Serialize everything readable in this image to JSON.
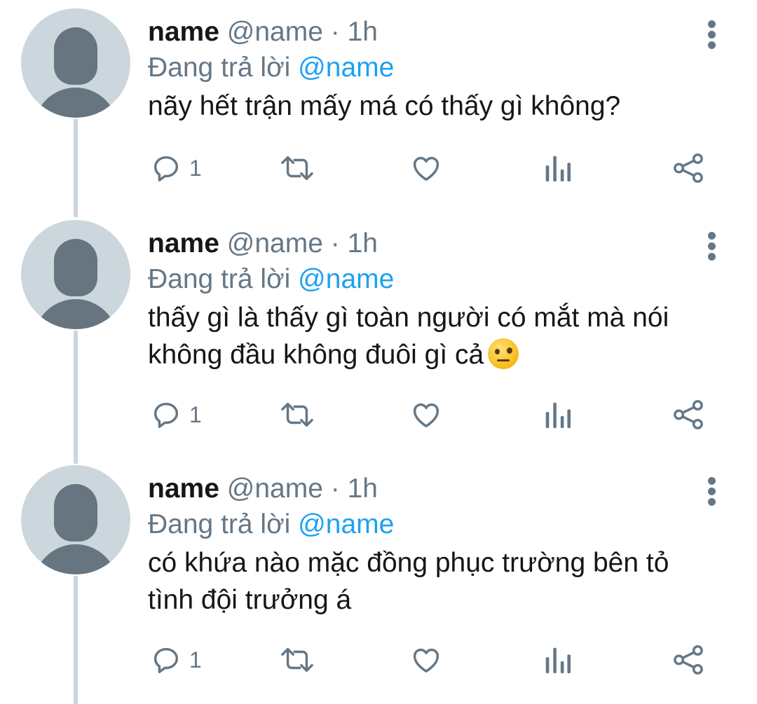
{
  "colors": {
    "text": "#14171a",
    "secondary": "#657786",
    "accent": "#1da1f2",
    "avatar_bg": "#ccd6dd",
    "avatar_fg": "#66757f",
    "thread_line": "#ccd6dd"
  },
  "icons": [
    "more-icon",
    "reply-icon",
    "retweet-icon",
    "like-icon",
    "analytics-icon",
    "share-icon",
    "default-avatar-icon"
  ],
  "tweets": [
    {
      "name": "name",
      "handle": "@name",
      "dot": "·",
      "time": "1h",
      "reply_prefix": "Đang trả lời",
      "reply_to": "@name",
      "text_lines": [
        "nãy hết trận mấy má có thấy gì không?"
      ],
      "emoji": null,
      "reply_count": "1"
    },
    {
      "name": "name",
      "handle": "@name",
      "dot": "·",
      "time": "1h",
      "reply_prefix": "Đang trả lời",
      "reply_to": "@name",
      "text_lines": [
        "thấy gì là thấy gì toàn người có mắt mà nói",
        "không đầu không đuôi gì cả"
      ],
      "emoji": "face-with-raised-eyebrow",
      "reply_count": "1"
    },
    {
      "name": "name",
      "handle": "@name",
      "dot": "·",
      "time": "1h",
      "reply_prefix": "Đang trả lời",
      "reply_to": "@name",
      "text_lines": [
        "có khứa nào mặc đồng phục trường bên tỏ",
        "tình đội trưởng á"
      ],
      "emoji": null,
      "reply_count": "1"
    }
  ]
}
